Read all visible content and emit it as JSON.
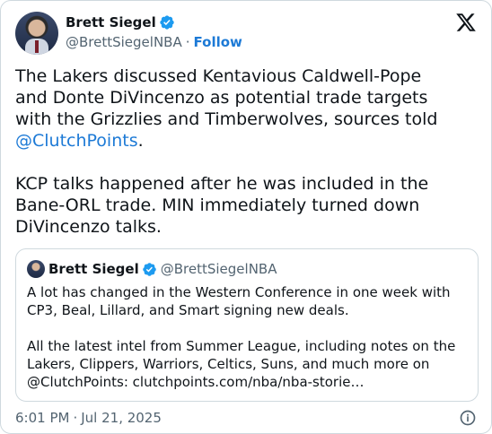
{
  "author": {
    "name": "Brett Siegel",
    "handle": "@BrettSiegelNBA",
    "separator": "·",
    "follow_label": "Follow"
  },
  "tweet": {
    "line1": "The Lakers discussed Kentavious Caldwell-Pope",
    "line2": "and Donte DiVincenzo as potential trade targets",
    "line3": "with the Grizzlies and Timberwolves, sources told",
    "mention": "@ClutchPoints",
    "mention_suffix": ".",
    "line5": "KCP talks happened after he was included in the",
    "line6": "Bane-ORL trade. MIN immediately turned down",
    "line7": "DiVincenzo talks."
  },
  "quote": {
    "name": "Brett Siegel",
    "handle": "@BrettSiegelNBA",
    "line1": "A lot has changed in the Western Conference in one week with",
    "line2": "CP3, Beal, Lillard, and Smart signing new deals.",
    "line3": "All the latest intel from Summer League, including notes on the",
    "line4": "Lakers, Clippers, Warriors, Celtics, Suns, and much more on",
    "line5": "@ClutchPoints: clutchpoints.com/nba/nba-storie…"
  },
  "footer": {
    "time": "6:01 PM",
    "separator": "·",
    "date": "Jul 21, 2025"
  },
  "colors": {
    "link": "#1d7ad6",
    "verified": "#1d9bf0",
    "secondary_text": "#536471",
    "border": "#cfd9de"
  },
  "icons": [
    "verified-badge-icon",
    "x-logo-icon",
    "info-icon"
  ]
}
